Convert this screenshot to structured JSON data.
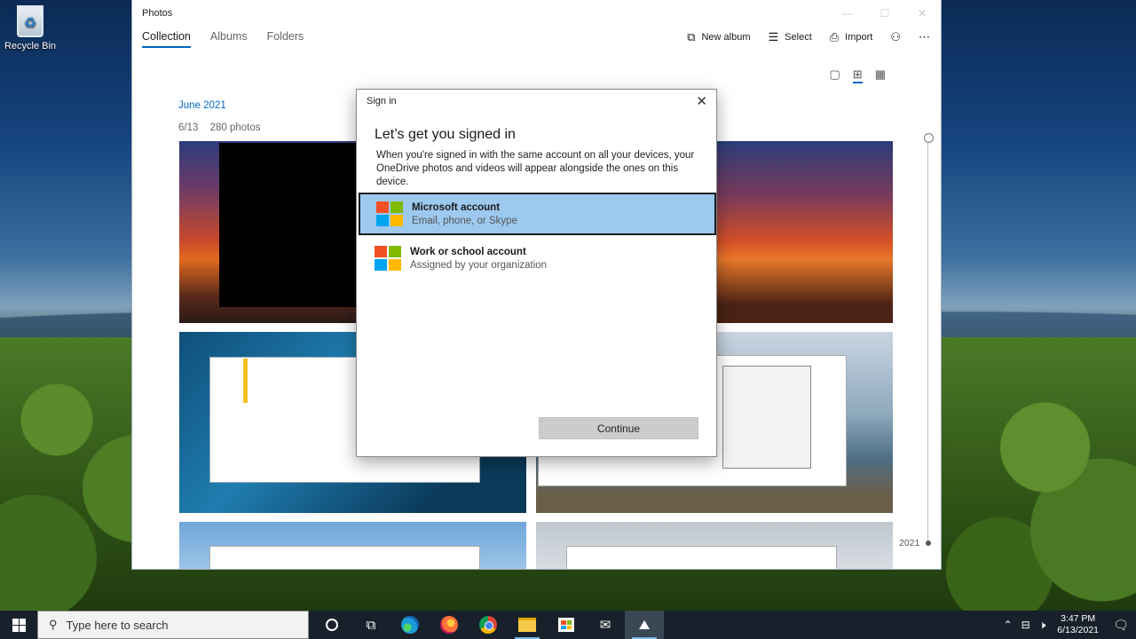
{
  "desktop": {
    "recycle_bin_label": "Recycle Bin"
  },
  "photos_window": {
    "title": "Photos",
    "nav_tabs": [
      "Collection",
      "Albums",
      "Folders"
    ],
    "active_tab": "Collection",
    "toolbar": {
      "new_album": "New album",
      "select": "Select",
      "import": "Import"
    },
    "month_header": "June 2021",
    "day_label": "6/13",
    "photo_count": "280 photos",
    "timeline_year": "2021"
  },
  "sign_in_dialog": {
    "title": "Sign in",
    "heading": "Let’s get you signed in",
    "description": "When you're signed in with the same account on all your devices, your OneDrive photos and videos will appear alongside the ones on this device.",
    "accounts": [
      {
        "name": "Microsoft account",
        "subtitle": "Email, phone, or Skype",
        "selected": true
      },
      {
        "name": "Work or school account",
        "subtitle": "Assigned by your organization",
        "selected": false
      }
    ],
    "continue_label": "Continue"
  },
  "taskbar": {
    "search_placeholder": "Type here to search",
    "time": "3:47 PM",
    "date": "6/13/2021"
  },
  "colors": {
    "accent": "#0067c0",
    "selected_account_bg": "#9dc9ef",
    "taskbar_bg": "#18212b"
  }
}
